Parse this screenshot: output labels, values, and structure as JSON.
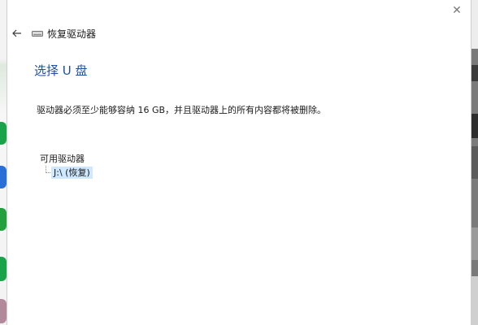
{
  "window": {
    "title": "恢复驱动器",
    "close_glyph": "✕"
  },
  "page": {
    "heading": "选择 U 盘",
    "description": "驱动器必须至少能够容纳 16 GB，并且驱动器上的所有内容都将被删除。"
  },
  "drives": {
    "group_label": "可用驱动器",
    "items": [
      {
        "label": "J:\\ (恢复)",
        "selected": true
      }
    ]
  },
  "colors": {
    "heading": "#1f4e9b",
    "selection": "#cde8ff"
  }
}
